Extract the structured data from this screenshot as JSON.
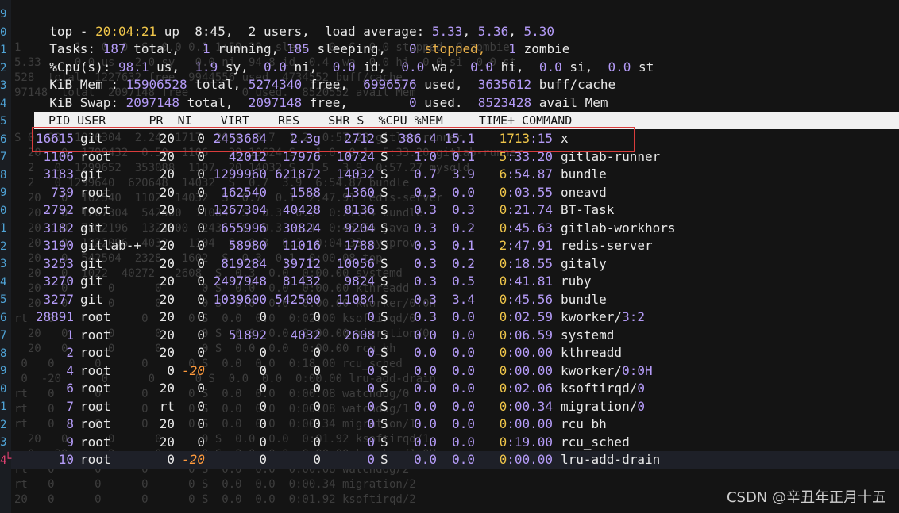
{
  "gutter_numbers": [
    "9",
    "0",
    "1",
    "2",
    "3",
    "4",
    "5",
    "6",
    "7",
    "8",
    "9",
    "0",
    "1",
    "2",
    "3",
    "4",
    "5",
    "6",
    "7",
    "8",
    "9",
    "0",
    "1",
    "2",
    "3",
    "4"
  ],
  "summary": {
    "line1": {
      "prefix": "top - ",
      "time": "20:04:21",
      "mid": " up  8:45,  2 users,  load average: ",
      "l1": "5.33",
      ", ": ", ",
      "l2": "5.36",
      "l3": "5.30"
    },
    "line2": {
      "label": "Tasks: ",
      "total": "187",
      "t_total": " total,   ",
      "running": "1",
      "t_running": " running, ",
      "sleeping": "185",
      "t_sleeping": " sleeping,   ",
      "stopped": "0",
      "t_stopped": " stopped,   ",
      "zombie": "1",
      "t_zombie": " zombie"
    },
    "line3": {
      "label": "%Cpu(s): ",
      "us": "98.1",
      "t_us": " us,  ",
      "sy": "1.9",
      "t_sy": " sy,  ",
      "ni": "0.0",
      "t_ni": " ni,  ",
      "id": "0.0",
      "t_id": " id,  ",
      "wa": "0.0",
      "t_wa": " wa,  ",
      "hi": "0.0",
      "t_hi": " hi,  ",
      "si": "0.0",
      "t_si": " si,  ",
      "st": "0.0",
      "t_st": " st"
    },
    "line4": {
      "label": "KiB Mem : ",
      "total": "15906528",
      "t_total": " total, ",
      "free": "5274340",
      "t_free": " free,  ",
      "used": "6996576",
      "t_used": " used,  ",
      "cache": "3635612",
      "t_cache": " buff/cache"
    },
    "line5": {
      "label": "KiB Swap: ",
      "total": "2097148",
      "t_total": " total,  ",
      "free": "2097148",
      "t_free": " free,        ",
      "used": "0",
      "t_used": " used.  ",
      "avail": "8523428",
      "t_avail": " avail Mem"
    }
  },
  "columns": "  PID USER      PR  NI    VIRT    RES    SHR S  %CPU %MEM     TIME+ COMMAND",
  "processes": [
    {
      "pid": "16615",
      "user": "git",
      "pr": "20",
      "ni": "0",
      "virt": "2453684",
      "res": "2.3g",
      "shr": "2712",
      "s": "S",
      "cpu": "386.4",
      "mem": "15.1",
      "time_a": "1713",
      "time_b": ":15",
      "cmd": "x",
      "cmd2": ""
    },
    {
      "pid": "1106",
      "user": "root",
      "pr": "20",
      "ni": "0",
      "virt": "42012",
      "res": "17976",
      "shr": "10724",
      "s": "S",
      "cpu": "1.0",
      "mem": "0.1",
      "time_a": "5",
      "time_b": ":33.20",
      "cmd": "gitlab-runner",
      "cmd2": ""
    },
    {
      "pid": "3183",
      "user": "git",
      "pr": "20",
      "ni": "0",
      "virt": "1299960",
      "res": "621872",
      "shr": "14032",
      "s": "S",
      "cpu": "0.7",
      "mem": "3.9",
      "time_a": "6",
      "time_b": ":54.87",
      "cmd": "bundle",
      "cmd2": ""
    },
    {
      "pid": "739",
      "user": "root",
      "pr": "20",
      "ni": "0",
      "virt": "162540",
      "res": "1588",
      "shr": "1360",
      "s": "S",
      "cpu": "0.3",
      "mem": "0.0",
      "time_a": "0",
      "time_b": ":03.55",
      "cmd": "oneavd",
      "cmd2": ""
    },
    {
      "pid": "2792",
      "user": "root",
      "pr": "20",
      "ni": "0",
      "virt": "1267304",
      "res": "40428",
      "shr": "8136",
      "s": "S",
      "cpu": "0.3",
      "mem": "0.3",
      "time_a": "0",
      "time_b": ":21.74",
      "cmd": "BT-Task",
      "cmd2": ""
    },
    {
      "pid": "3182",
      "user": "git",
      "pr": "20",
      "ni": "0",
      "virt": "655996",
      "res": "30824",
      "shr": "9204",
      "s": "S",
      "cpu": "0.3",
      "mem": "0.2",
      "time_a": "0",
      "time_b": ":45.63",
      "cmd": "gitlab-workhors",
      "cmd2": ""
    },
    {
      "pid": "3190",
      "user": "gitlab-+",
      "pr": "20",
      "ni": "0",
      "virt": "58980",
      "res": "11016",
      "shr": "1788",
      "s": "S",
      "cpu": "0.3",
      "mem": "0.1",
      "time_a": "2",
      "time_b": ":47.91",
      "cmd": "redis-server",
      "cmd2": ""
    },
    {
      "pid": "3253",
      "user": "git",
      "pr": "20",
      "ni": "0",
      "virt": "819284",
      "res": "39712",
      "shr": "10056",
      "s": "S",
      "cpu": "0.3",
      "mem": "0.2",
      "time_a": "0",
      "time_b": ":18.55",
      "cmd": "gitaly",
      "cmd2": ""
    },
    {
      "pid": "3270",
      "user": "git",
      "pr": "20",
      "ni": "0",
      "virt": "2497948",
      "res": "81432",
      "shr": "9824",
      "s": "S",
      "cpu": "0.3",
      "mem": "0.5",
      "time_a": "0",
      "time_b": ":41.81",
      "cmd": "ruby",
      "cmd2": ""
    },
    {
      "pid": "3277",
      "user": "git",
      "pr": "20",
      "ni": "0",
      "virt": "1039600",
      "res": "542500",
      "shr": "11084",
      "s": "S",
      "cpu": "0.3",
      "mem": "3.4",
      "time_a": "0",
      "time_b": ":45.56",
      "cmd": "bundle",
      "cmd2": ""
    },
    {
      "pid": "28891",
      "user": "root",
      "pr": "20",
      "ni": "0",
      "virt": "0",
      "res": "0",
      "shr": "0",
      "s": "S",
      "cpu": "0.3",
      "mem": "0.0",
      "time_a": "0",
      "time_b": ":02.59",
      "cmd": "kworker/",
      "cmd2": "3:2"
    },
    {
      "pid": "1",
      "user": "root",
      "pr": "20",
      "ni": "0",
      "virt": "51892",
      "res": "4032",
      "shr": "2608",
      "s": "S",
      "cpu": "0.0",
      "mem": "0.0",
      "time_a": "0",
      "time_b": ":06.59",
      "cmd": "systemd",
      "cmd2": ""
    },
    {
      "pid": "2",
      "user": "root",
      "pr": "20",
      "ni": "0",
      "virt": "0",
      "res": "0",
      "shr": "0",
      "s": "S",
      "cpu": "0.0",
      "mem": "0.0",
      "time_a": "0",
      "time_b": ":00.00",
      "cmd": "kthreadd",
      "cmd2": ""
    },
    {
      "pid": "4",
      "user": "root",
      "pr": "0",
      "ni": "-20",
      "virt": "0",
      "res": "0",
      "shr": "0",
      "s": "S",
      "cpu": "0.0",
      "mem": "0.0",
      "time_a": "0",
      "time_b": ":00.00",
      "cmd": "kworker/",
      "cmd2": "0:0H"
    },
    {
      "pid": "6",
      "user": "root",
      "pr": "20",
      "ni": "0",
      "virt": "0",
      "res": "0",
      "shr": "0",
      "s": "S",
      "cpu": "0.0",
      "mem": "0.0",
      "time_a": "0",
      "time_b": ":02.06",
      "cmd": "ksoftirqd/",
      "cmd2": "0"
    },
    {
      "pid": "7",
      "user": "root",
      "pr": "rt",
      "ni": "0",
      "virt": "0",
      "res": "0",
      "shr": "0",
      "s": "S",
      "cpu": "0.0",
      "mem": "0.0",
      "time_a": "0",
      "time_b": ":00.34",
      "cmd": "migration/",
      "cmd2": "0"
    },
    {
      "pid": "8",
      "user": "root",
      "pr": "20",
      "ni": "0",
      "virt": "0",
      "res": "0",
      "shr": "0",
      "s": "S",
      "cpu": "0.0",
      "mem": "0.0",
      "time_a": "0",
      "time_b": ":00.00",
      "cmd": "rcu_bh",
      "cmd2": ""
    },
    {
      "pid": "9",
      "user": "root",
      "pr": "20",
      "ni": "0",
      "virt": "0",
      "res": "0",
      "shr": "0",
      "s": "S",
      "cpu": "0.0",
      "mem": "0.0",
      "time_a": "0",
      "time_b": ":19.00",
      "cmd": "rcu_sched",
      "cmd2": ""
    },
    {
      "pid": "10",
      "user": "root",
      "pr": "0",
      "ni": "-20",
      "virt": "0",
      "res": "0",
      "shr": "0",
      "s": "S",
      "cpu": "0.0",
      "mem": "0.0",
      "time_a": "0",
      "time_b": ":00.00",
      "cmd": "lru-add-drain",
      "cmd2": ""
    }
  ],
  "ghost_lines": [
    "",
    "",
    "1        1   0  0  S  0.0 0.1 1:59.28  sleep   0  S  0.0 stopped  0 zombie",
    "5.33     0.0 us   2.0 sy   0.0 ni  94.8 id  0.4  wa  0.0 hi  0.0 si  0.0 st",
    "528  total  1227632 free  9944556 used  4734552 buff/cache",
    "97148  total  2097148 free        0 used.  8520552 avail Mem",
    "",
    "",
    "S 0  20  1020304  2.24  1717  20 x  0.7  1.2  0:57.28 gitlab-runner",
    "  20   0  1799432  0.50  1106   20 10624 S   1.0  0.1  5:33.20 gitlab-runner",
    "  2   0  1299652  353088  1107  20 14032 S  1.5  3.9  0:57.27 mysqld",
    "  2   0 1299640  620648  14032  S  0.7  3.9  6:54.87 bundle",
    "  20   0  162540  1102  14032  S  0.7  0.1  2:47.91 redis-server",
    "  20   0  1267304  542500  11084  S  0.3  0.3  0:21.74 bundle",
    "  20   0  7802196  1324000  2436  S  0.3  3.4  0:45.56 java",
    "  20   0  1222096  4032   1104  S  0.3  0.1  0:04.33 sysprov",
    "  20   0  542504  2328   1602  S  0.3  0.1  0:00.08 top",
    "  20   0  1022  40272   2608  S  0.3  0.0  0:00.00 systemd",
    "  20   0      0      0      0 S  0.0  0.0  0:00.00 kthreadd",
    "  20   0      0      0      0 S  0.0  0.0  0:00.00 kworker/0:0H",
    "rt   0      0      0      0 S  0.0  0.0  0:02.00 ksoftirqd/0",
    "  20   0      0      0      0 S  0.0  0.0  0:00.00 migration/0",
    "  20   0      0      0      0 S  0.0  0.0  0:00.00 rcu_bh",
    " 0   0      0      0      0 S  0.0  0.0  0:18.00 rcu_sched",
    " 0  -20      0      0      0 S  0.0  0.0  0:00.00 lru-add-drain",
    "rt   0      0      0      0 S  0.0  0.0  0:00.08 watchdog/0",
    "rt   0      0      0      0 S  0.0  0.0  0:00.08 watchdog/1",
    "rt   0      0      0      0 S  0.0  0.0  0:00.34 migration/1",
    "  20   0      0      0      0 S  0.0  0.0  0:01.92 ksoftirqd/1",
    "  0  -20      0      0      0 S  0.0  0.0  0:00.00 kworker/1:0H",
    "rt   0      0      0      0 S  0.0  0.0  0:00.08 watchdog/2",
    "rt   0      0      0      0 S  0.0  0.0  0:00.34 migration/2",
    "20   0      0      0      0 S  0.0  0.0  0:01.92 ksoftirqd/2"
  ],
  "watermark": "CSDN @辛丑年正月十五",
  "colors": {
    "number": "#b49bf7",
    "time_highlight": "#f0c64a",
    "negative_nice": "#ff9a3c",
    "stopped": "#e8b04a",
    "highlight_box": "#d93c3c"
  }
}
